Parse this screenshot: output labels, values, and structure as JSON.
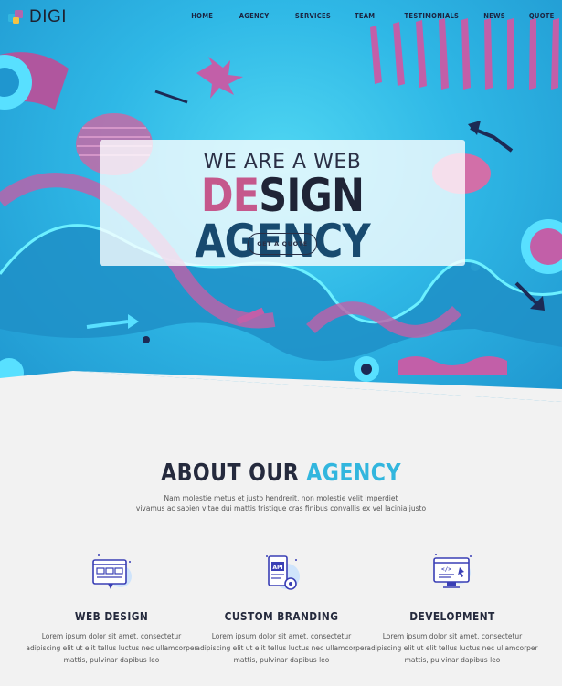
{
  "brand": {
    "name": "DIGI"
  },
  "nav": {
    "items": [
      "HOME",
      "AGENCY",
      "SERVICES",
      "TEAM",
      "TESTIMONIALS",
      "NEWS",
      "QUOTE"
    ]
  },
  "hero": {
    "line1": "WE ARE A WEB",
    "line2_a": "DE",
    "line2_b": "SIGN",
    "line2_c": "AGENCY",
    "button": "GET A QUOTE"
  },
  "about": {
    "title_a": "ABOUT OUR",
    "title_b": "AGENCY",
    "desc_1": "Nam molestie metus et justo hendrerit, non molestie velit imperdiet",
    "desc_2": "vivamus ac sapien vitae dui mattis tristique cras finibus convallis ex vel lacinia justo"
  },
  "features": [
    {
      "icon": "web-design-icon",
      "title": "WEB DESIGN",
      "line1": "Lorem ipsum dolor sit amet, consectetur",
      "line2": "adipiscing elit ut elit tellus luctus nec ullamcorper",
      "line3": "mattis, pulvinar dapibus leo"
    },
    {
      "icon": "branding-icon",
      "title": "CUSTOM BRANDING",
      "line1": "Lorem ipsum dolor sit amet, consectetur",
      "line2": "adipiscing elit ut elit tellus luctus nec ullamcorper",
      "line3": "mattis, pulvinar dapibus leo"
    },
    {
      "icon": "development-icon",
      "title": "DEVELOPMENT",
      "line1": "Lorem ipsum dolor sit amet, consectetur",
      "line2": "adipiscing elit ut elit tellus luctus nec ullamcorper",
      "line3": "mattis, pulvinar dapibus leo"
    }
  ],
  "colors": {
    "accent": "#32b6de",
    "pink": "#c5588c",
    "dark": "#252a3d",
    "navy": "#184a6f"
  }
}
